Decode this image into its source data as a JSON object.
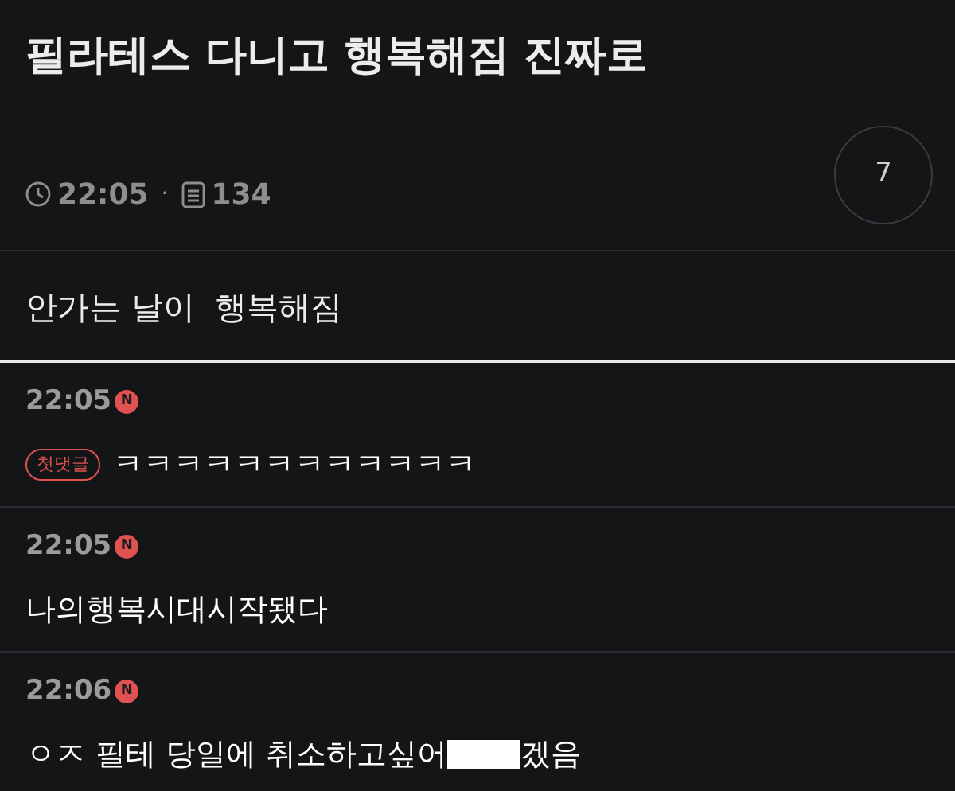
{
  "post": {
    "title": "필라테스 다니고 행복해짐 진짜로",
    "time": "22:05",
    "separator": "·",
    "views": "134",
    "comment_count": "7",
    "body": "안가는 날이  행복해짐"
  },
  "comments": [
    {
      "time": "22:05",
      "new": true,
      "new_label": "N",
      "tag": "첫댓글",
      "text": "ㅋㅋㅋㅋㅋㅋㅋㅋㅋㅋㅋㅋ",
      "redacted": false
    },
    {
      "time": "22:05",
      "new": true,
      "new_label": "N",
      "text": "나의행복시대시작됐다",
      "redacted": false
    },
    {
      "time": "22:06",
      "new": true,
      "new_label": "N",
      "text": "ㅇㅈ 필테 당일에 취소하고싶어",
      "redacted": true,
      "text_after": "겠음"
    }
  ]
}
